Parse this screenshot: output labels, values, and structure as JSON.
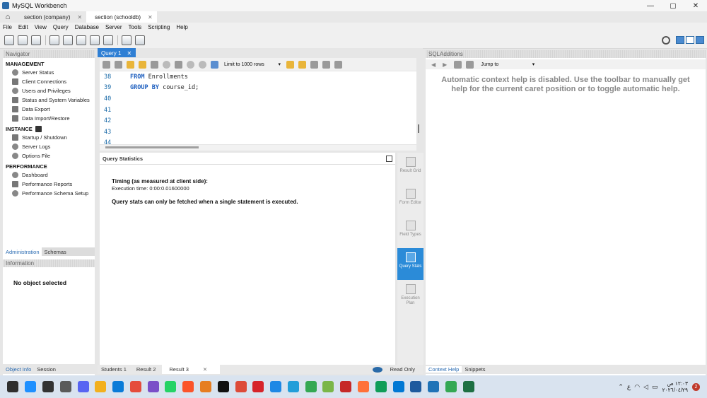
{
  "window": {
    "title": "MySQL Workbench",
    "controls": [
      "—",
      "▢",
      "✕"
    ]
  },
  "connection_tabs": [
    {
      "label": "section  (company)",
      "active": false
    },
    {
      "label": "section  (schooldb)",
      "active": true
    }
  ],
  "menu": [
    "File",
    "Edit",
    "View",
    "Query",
    "Database",
    "Server",
    "Tools",
    "Scripting",
    "Help"
  ],
  "navigator": {
    "header": "Navigator",
    "management": {
      "title": "MANAGEMENT",
      "items": [
        "Server Status",
        "Client Connections",
        "Users and Privileges",
        "Status and System Variables",
        "Data Export",
        "Data Import/Restore"
      ]
    },
    "instance": {
      "title": "INSTANCE",
      "items": [
        "Startup / Shutdown",
        "Server Logs",
        "Options File"
      ]
    },
    "performance": {
      "title": "PERFORMANCE",
      "items": [
        "Dashboard",
        "Performance Reports",
        "Performance Schema Setup"
      ]
    },
    "tabs": [
      "Administration",
      "Schemas"
    ],
    "info_header": "Information",
    "info_text": "No object selected",
    "bottom_tabs": [
      "Object Info",
      "Session"
    ]
  },
  "query_tab": {
    "label": "Query 1"
  },
  "editor_toolbar": {
    "limit_label": "Limit to 1000 rows"
  },
  "editor": {
    "lines": [
      {
        "no": "38",
        "kw": "FROM",
        "text": " Enrollments"
      },
      {
        "no": "39",
        "kw": "GROUP BY",
        "text": " course_id;"
      },
      {
        "no": "40",
        "kw": "",
        "text": ""
      },
      {
        "no": "41",
        "kw": "",
        "text": ""
      },
      {
        "no": "42",
        "kw": "",
        "text": ""
      },
      {
        "no": "43",
        "kw": "",
        "text": ""
      },
      {
        "no": "44",
        "kw": "",
        "text": ""
      }
    ]
  },
  "results": {
    "header": "Query Statistics",
    "timing_title": "Timing (as measured at client side):",
    "execution_time": "Execution time: 0:00:0.01600000",
    "stats_note": "Query stats can only be fetched when a single statement is executed."
  },
  "side_panel": [
    {
      "label": "Result Grid",
      "active": false
    },
    {
      "label": "Form Editor",
      "active": false
    },
    {
      "label": "Field Types",
      "active": false
    },
    {
      "label": "Query Stats",
      "active": true
    },
    {
      "label": "Execution Plan",
      "active": false
    }
  ],
  "result_tabs": [
    "Students 1",
    "Result 2",
    "Result 3"
  ],
  "read_only": "Read Only",
  "sql_additions": {
    "header": "SQLAdditions",
    "jump_to": "Jump to",
    "help_text": "Automatic context help is disabled. Use the toolbar to manually get help for the current caret position or to toggle automatic help.",
    "tabs": [
      "Context Help",
      "Snippets"
    ]
  },
  "taskbar": {
    "time": "١٢:٠٣ ص",
    "date": "٢٠٢٦/٠٤/٢٩",
    "lang": "ع",
    "notification_count": "2",
    "app_colors": [
      "#2f2f2f",
      "#1e90ff",
      "#333333",
      "#5a5a5a",
      "#5865f2",
      "#f2b01e",
      "#0a7bd8",
      "#e54c3c",
      "#7a4fc8",
      "#25d366",
      "#fb542b",
      "#e67e22",
      "#111111",
      "#dd4b39",
      "#d6232a",
      "#1e88e5",
      "#229ed9",
      "#34a853",
      "#7ab648",
      "#c62828",
      "#ff7139",
      "#0f9d58",
      "#0078d4",
      "#1e5a9e",
      "#1f73b7",
      "#34a853",
      "#1d6f42"
    ]
  }
}
